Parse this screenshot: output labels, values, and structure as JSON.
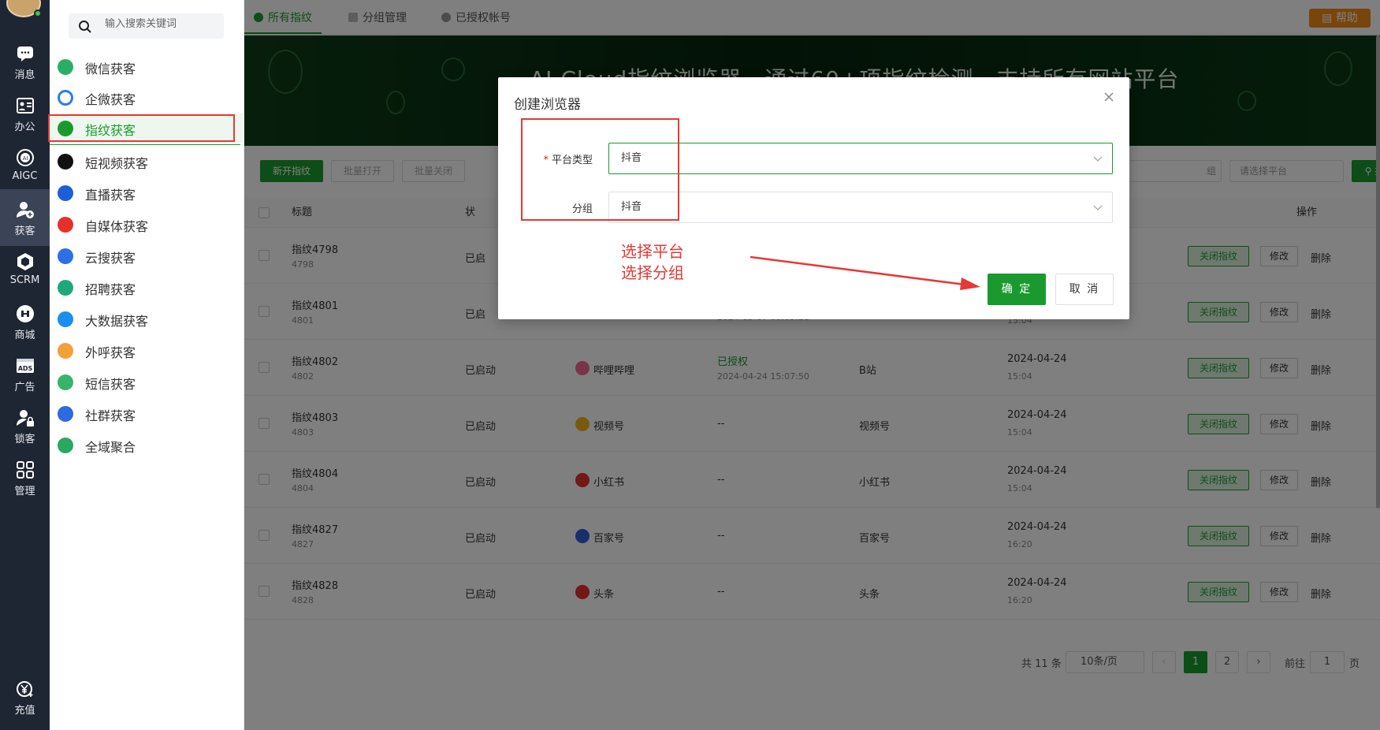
{
  "rail": {
    "items": [
      {
        "label": "消息",
        "icon": "chat-icon"
      },
      {
        "label": "办公",
        "icon": "office-icon"
      },
      {
        "label": "AIGC",
        "icon": "ai-icon"
      },
      {
        "label": "获客",
        "icon": "user-add-icon",
        "active": true
      },
      {
        "label": "SCRM",
        "icon": "cube-icon"
      },
      {
        "label": "商城",
        "icon": "shop-icon"
      },
      {
        "label": "广告",
        "icon": "ads-icon"
      },
      {
        "label": "锁客",
        "icon": "user-lock-icon"
      },
      {
        "label": "管理",
        "icon": "grid-icon"
      },
      {
        "label": "充值",
        "icon": "yen-icon"
      }
    ]
  },
  "sidebar": {
    "search_placeholder": "输入搜索关键词",
    "items": [
      {
        "label": "微信获客",
        "icon": "wechat-icon",
        "color": "#2aae67"
      },
      {
        "label": "企微获客",
        "icon": "wecom-icon",
        "color": "#2b7de9"
      },
      {
        "label": "指纹获客",
        "icon": "fingerprint-icon",
        "color": "#1a9a2e",
        "active": true
      },
      {
        "label": "短视频获客",
        "icon": "tiktok-icon",
        "color": "#111111"
      },
      {
        "label": "直播获客",
        "icon": "live-camera-icon",
        "color": "#1d5fd8"
      },
      {
        "label": "自媒体获客",
        "icon": "media-icon",
        "color": "#e5312c"
      },
      {
        "label": "云搜获客",
        "icon": "paw-icon",
        "color": "#2f6fe6"
      },
      {
        "label": "招聘获客",
        "icon": "recruit-icon",
        "color": "#1fa97a"
      },
      {
        "label": "大数据获客",
        "icon": "bigdata-icon",
        "color": "#1c8ef0"
      },
      {
        "label": "外呼获客",
        "icon": "call-icon",
        "color": "#f2a03a"
      },
      {
        "label": "短信获客",
        "icon": "sms-icon",
        "color": "#36b56a"
      },
      {
        "label": "社群获客",
        "icon": "community-icon",
        "color": "#2e6ae0"
      },
      {
        "label": "全域聚合",
        "icon": "aggregate-icon",
        "color": "#2aa862"
      }
    ]
  },
  "topbar": {
    "tabs": [
      {
        "label": "所有指纹",
        "active": true
      },
      {
        "label": "分组管理"
      },
      {
        "label": "已授权帐号"
      }
    ],
    "help_label": "帮助"
  },
  "banner": {
    "title": "AI Cloud指纹浏览器，通过60+项指纹检测，支持所有网站平台"
  },
  "toolbar": {
    "new_label": "新开指纹",
    "batch_open_label": "批量打开",
    "batch_close_label": "批量关闭",
    "group_select_tail": "组",
    "platform_placeholder": "请选择平台",
    "search_label": "搜索"
  },
  "table": {
    "headers": {
      "title": "标题",
      "status": "状",
      "action": "操作"
    },
    "rows": [
      {
        "title": "指纹4798",
        "id": "4798",
        "status": "已启",
        "platform": "",
        "auth": "",
        "auth_time": "",
        "group": "",
        "date": "",
        "time": ""
      },
      {
        "title": "指纹4801",
        "id": "4801",
        "status": "已启",
        "platform": "",
        "auth": "",
        "auth_time": "2024-05-07 00:05:21",
        "group": "",
        "date": "",
        "time": "15:04"
      },
      {
        "title": "指纹4802",
        "id": "4802",
        "status": "已启动",
        "platform": "哔哩哔哩",
        "platform_color": "#f06a95",
        "auth": "已授权",
        "auth_time": "2024-04-24 15:07:50",
        "group": "B站",
        "date": "2024-04-24",
        "time": "15:04"
      },
      {
        "title": "指纹4803",
        "id": "4803",
        "status": "已启动",
        "platform": "视频号",
        "platform_color": "#f2b51a",
        "auth": "--",
        "auth_time": "",
        "group": "视频号",
        "date": "2024-04-24",
        "time": "15:04"
      },
      {
        "title": "指纹4804",
        "id": "4804",
        "status": "已启动",
        "platform": "小红书",
        "platform_color": "#e5312c",
        "auth": "--",
        "auth_time": "",
        "group": "小红书",
        "date": "2024-04-24",
        "time": "15:04"
      },
      {
        "title": "指纹4827",
        "id": "4827",
        "status": "已启动",
        "platform": "百家号",
        "platform_color": "#2f5fd6",
        "auth": "--",
        "auth_time": "",
        "group": "百家号",
        "date": "2024-04-24",
        "time": "16:20"
      },
      {
        "title": "指纹4828",
        "id": "4828",
        "status": "已启动",
        "platform": "头条",
        "platform_color": "#e5312c",
        "auth": "--",
        "auth_time": "",
        "group": "头条",
        "date": "2024-04-24",
        "time": "16:20"
      }
    ],
    "row_actions": {
      "close": "关闭指纹",
      "edit": "修改",
      "delete": "删除"
    }
  },
  "pagination": {
    "total": "共 11 条",
    "page_size": "10条/页",
    "pages": [
      "1",
      "2"
    ],
    "current": "1",
    "goto_label": "前往",
    "goto_value": "1",
    "page_suffix": "页"
  },
  "modal": {
    "title": "创建浏览器",
    "required_mark": "*",
    "platform_label": "平台类型",
    "platform_value": "抖音",
    "group_label": "分组",
    "group_value": "抖音",
    "ok_label": "确 定",
    "cancel_label": "取 消"
  },
  "annotation": {
    "line1": "选择平台",
    "line2": "选择分组",
    "color": "#e53935"
  },
  "colors": {
    "brand": "#1a9a2e",
    "help": "#f08a1a",
    "rail": "#1f2633"
  }
}
